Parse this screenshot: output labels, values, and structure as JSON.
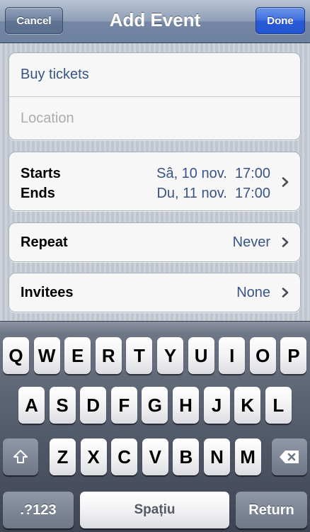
{
  "navbar": {
    "title": "Add Event",
    "cancel_label": "Cancel",
    "done_label": "Done"
  },
  "event": {
    "title_value": "Buy tickets",
    "location_placeholder": "Location"
  },
  "dates": {
    "starts_label": "Starts",
    "ends_label": "Ends",
    "starts_date": "Sâ, 10 nov.",
    "starts_time": "17:00",
    "ends_date": "Du, 11 nov.",
    "ends_time": "17:00"
  },
  "repeat": {
    "label": "Repeat",
    "value": "Never"
  },
  "invitees": {
    "label": "Invitees",
    "value": "None"
  },
  "keyboard": {
    "row1": [
      "Q",
      "W",
      "E",
      "R",
      "T",
      "Y",
      "U",
      "I",
      "O",
      "P"
    ],
    "row2": [
      "A",
      "S",
      "D",
      "F",
      "G",
      "H",
      "J",
      "K",
      "L"
    ],
    "row3": [
      "Z",
      "X",
      "C",
      "V",
      "B",
      "N",
      "M"
    ],
    "shift_icon": "shift-arrow-icon",
    "delete_icon": "backspace-icon",
    "numbers_label": ".?123",
    "space_label": "Spațiu",
    "return_label": "Return"
  },
  "colors": {
    "nav_bar": "#7487a4",
    "done_button": "#2a5ad6",
    "value_text": "#385487",
    "placeholder_text": "#acacac"
  }
}
